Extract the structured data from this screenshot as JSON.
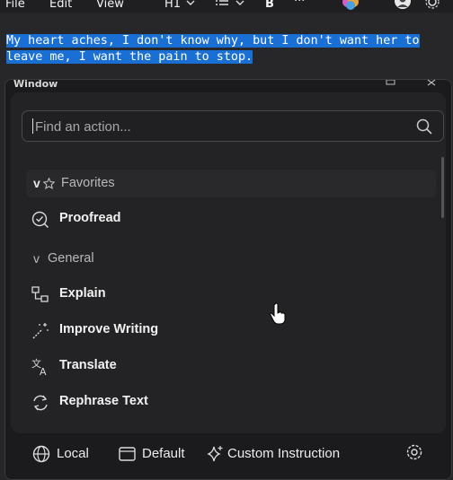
{
  "menubar": {
    "file": "File",
    "edit": "Edit",
    "view": "View",
    "heading": "H1",
    "bold": "B",
    "more": "···"
  },
  "editor": {
    "line1": "My heart aches, I don't know why, but I don't want her to",
    "line2": "leave me, I want the pain to stop."
  },
  "window": {
    "title": "Window",
    "search_placeholder": "Find an action...",
    "sections": {
      "favorites": {
        "chevron": "v",
        "label": "Favorites"
      },
      "general": {
        "chevron": "v",
        "label": "General"
      }
    },
    "favorites_items": [
      {
        "label": "Proofread",
        "icon": "proofread-icon"
      }
    ],
    "general_items": [
      {
        "label": "Explain",
        "icon": "explain-icon"
      },
      {
        "label": "Improve Writing",
        "icon": "magic-wand-icon"
      },
      {
        "label": "Translate",
        "icon": "translate-icon"
      },
      {
        "label": "Rephrase Text",
        "icon": "rephrase-icon"
      }
    ],
    "footer": {
      "local": "Local",
      "default": "Default",
      "custom": "Custom Instruction"
    }
  },
  "colors": {
    "selection": "#1a6fd4",
    "window_bg": "#1b1b1d",
    "panel_bg": "#232325"
  }
}
